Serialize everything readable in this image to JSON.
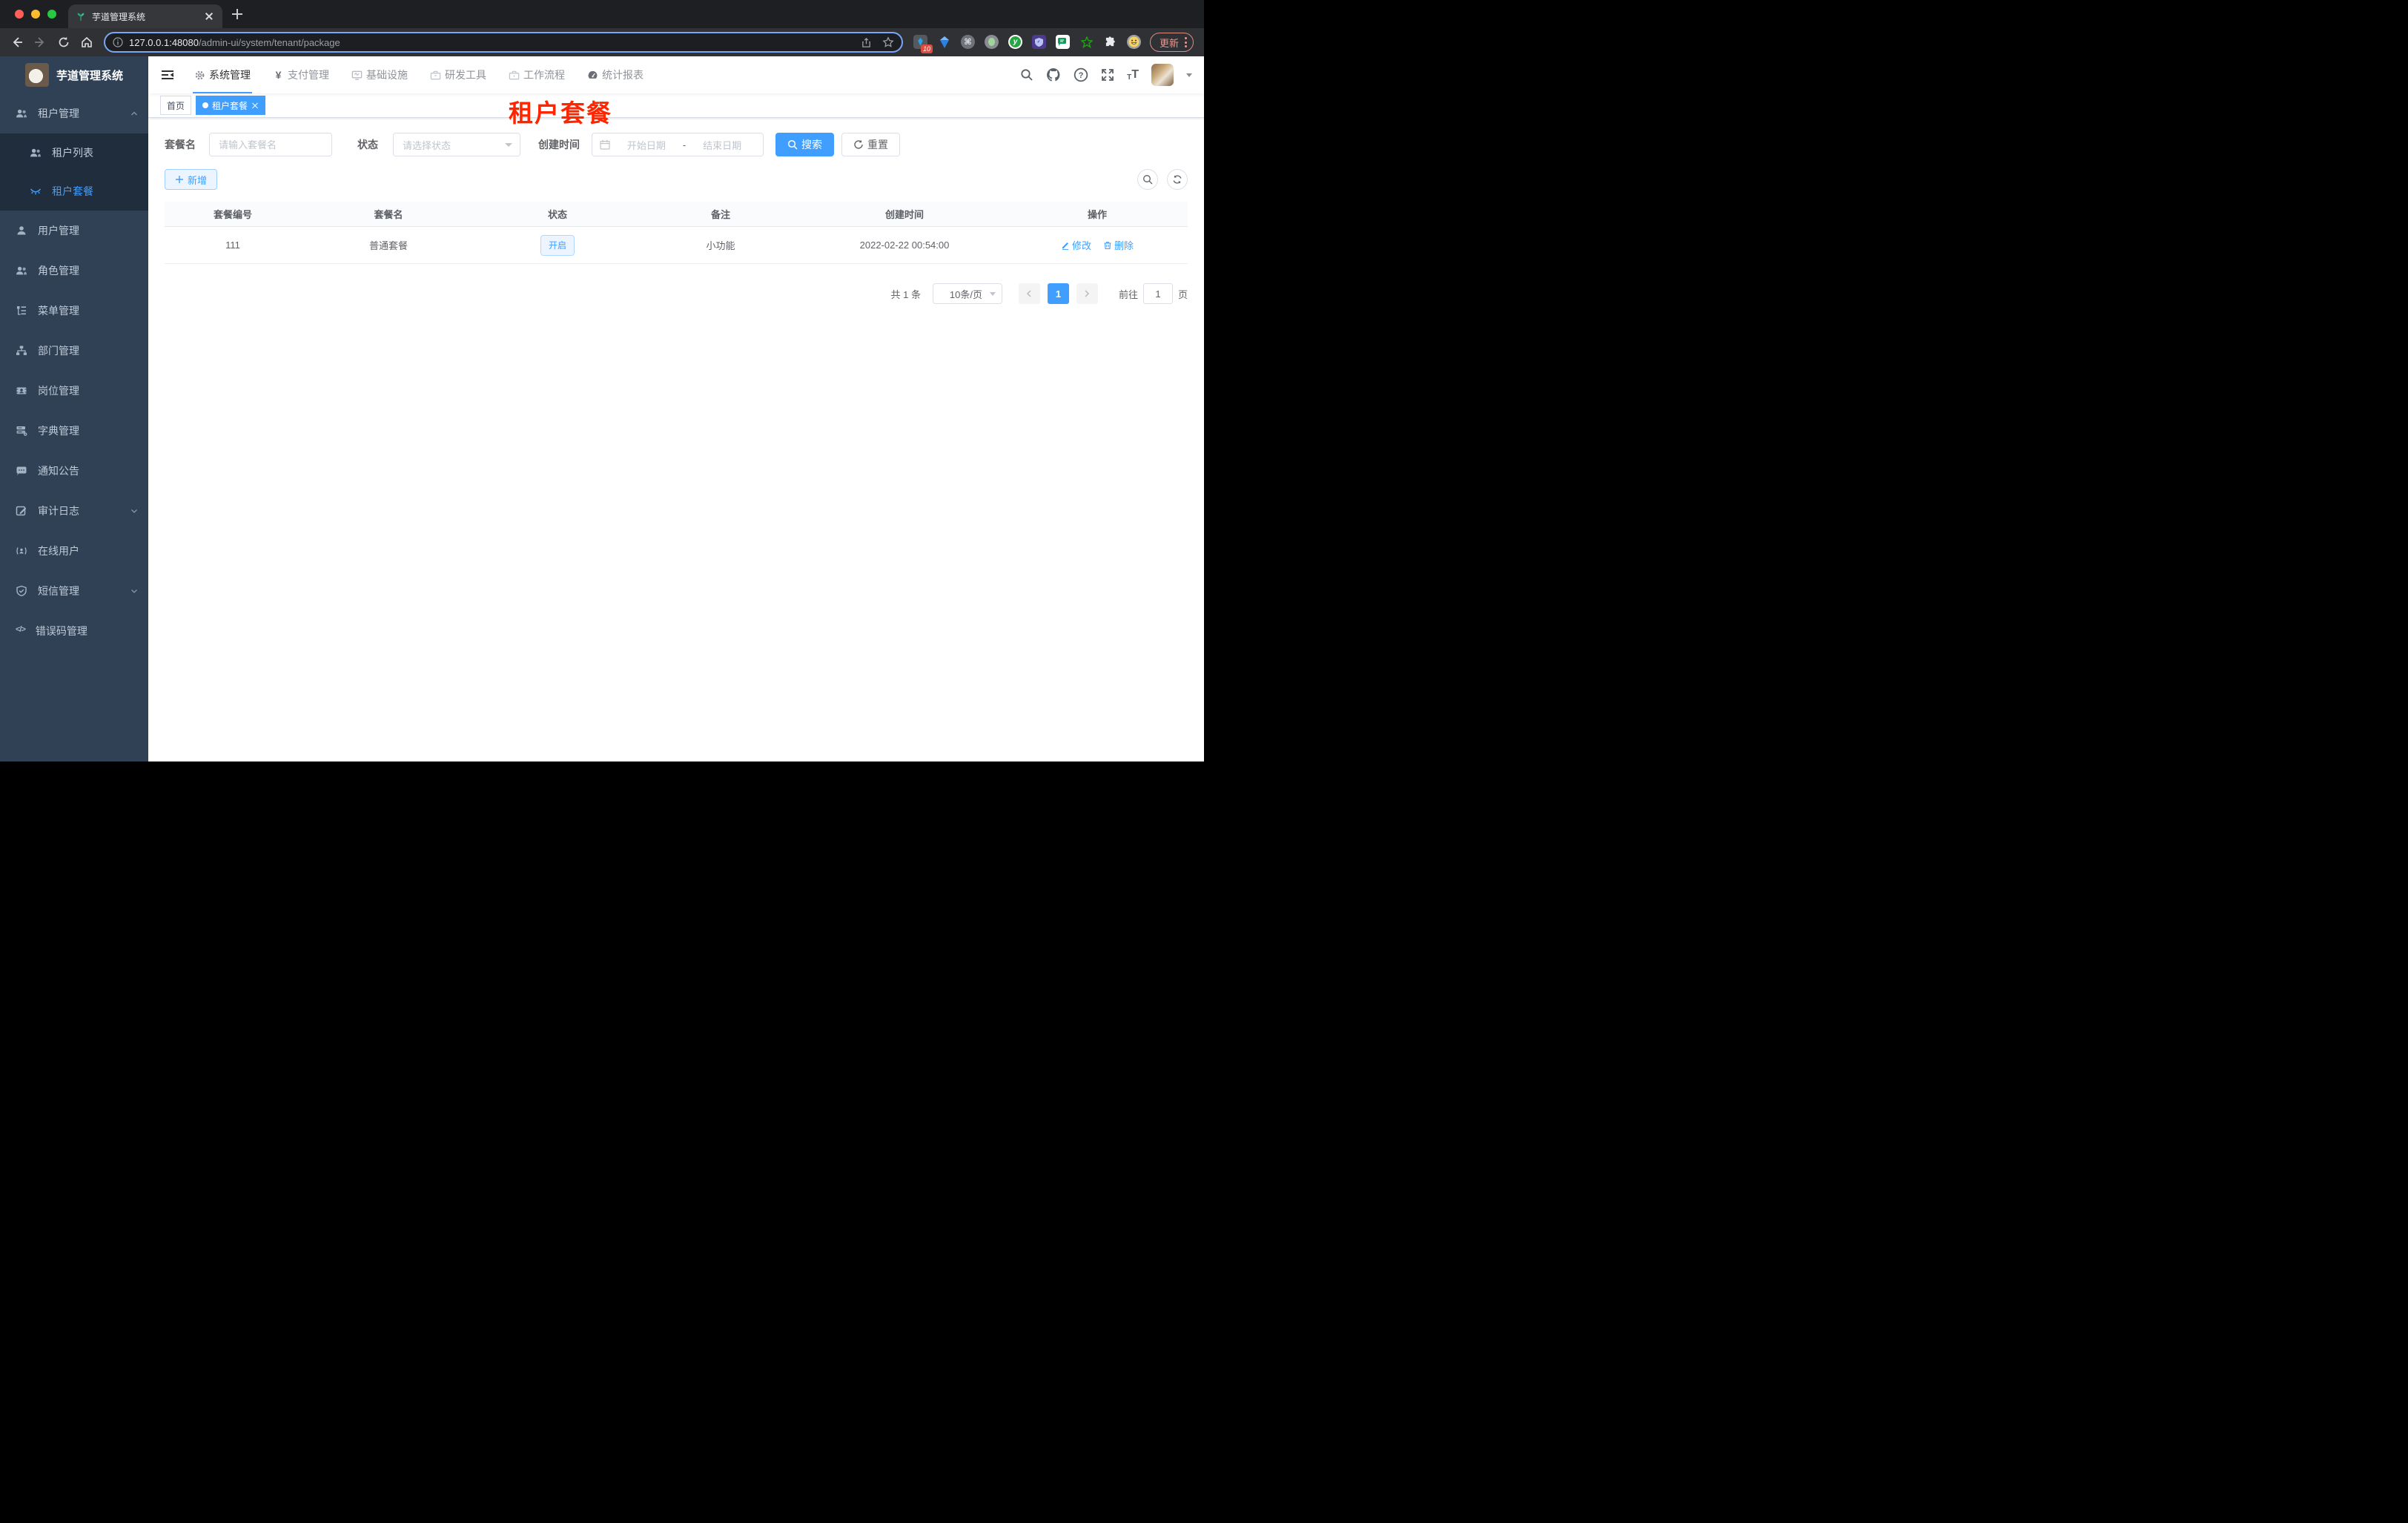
{
  "browser": {
    "tab_title": "芋道管理系统",
    "url_host": "127.0.0.1:48080",
    "url_path": "/admin-ui/system/tenant/package",
    "extension_badge": "10",
    "update_label": "更新"
  },
  "glyphs": {
    "yen": "¥",
    "question": "?",
    "code": "</>",
    "command": "⌘",
    "y_ext": "y",
    "font_small": "T",
    "font_big": "T"
  },
  "sidebar": {
    "logo_title": "芋道管理系统",
    "items": [
      {
        "label": "租户管理",
        "icon": "peoples-icon"
      },
      {
        "label": "租户列表",
        "icon": "peoples-icon"
      },
      {
        "label": "租户套餐",
        "icon": "package-icon"
      },
      {
        "label": "用户管理",
        "icon": "user-icon"
      },
      {
        "label": "角色管理",
        "icon": "peoples-icon"
      },
      {
        "label": "菜单管理",
        "icon": "tree-table-icon"
      },
      {
        "label": "部门管理",
        "icon": "org-tree-icon"
      },
      {
        "label": "岗位管理",
        "icon": "post-icon"
      },
      {
        "label": "字典管理",
        "icon": "dict-icon"
      },
      {
        "label": "通知公告",
        "icon": "message-icon"
      },
      {
        "label": "审计日志",
        "icon": "log-icon"
      },
      {
        "label": "在线用户",
        "icon": "online-icon"
      },
      {
        "label": "短信管理",
        "icon": "shield-icon"
      },
      {
        "label": "错误码管理",
        "icon": "code-icon"
      }
    ]
  },
  "nav": {
    "items": [
      {
        "label": "系统管理",
        "icon": "gear-icon",
        "active": true
      },
      {
        "label": "支付管理",
        "icon": "yen-icon"
      },
      {
        "label": "基础设施",
        "icon": "monitor-icon"
      },
      {
        "label": "研发工具",
        "icon": "toolbox-icon"
      },
      {
        "label": "工作流程",
        "icon": "briefcase-icon"
      },
      {
        "label": "统计报表",
        "icon": "dashboard-icon"
      }
    ]
  },
  "tags": {
    "home": "首页",
    "active": "租户套餐"
  },
  "annotation": "租户套餐",
  "filters": {
    "name_label": "套餐名",
    "name_placeholder": "请输入套餐名",
    "status_label": "状态",
    "status_placeholder": "请选择状态",
    "date_label": "创建时间",
    "date_start_placeholder": "开始日期",
    "date_separator": "-",
    "date_end_placeholder": "结束日期",
    "search_label": "搜索",
    "reset_label": "重置"
  },
  "toolbar": {
    "add_label": "新增"
  },
  "table": {
    "columns": [
      "套餐编号",
      "套餐名",
      "状态",
      "备注",
      "创建时间",
      "操作"
    ],
    "rows": [
      {
        "id": "111",
        "name": "普通套餐",
        "status": "开启",
        "remark": "小功能",
        "created": "2022-02-22 00:54:00",
        "edit_label": "修改",
        "delete_label": "删除"
      }
    ]
  },
  "pagination": {
    "total": "共 1 条",
    "page_size": "10条/页",
    "current_page": "1",
    "goto_label": "前往",
    "goto_value": "1",
    "page_unit": "页"
  },
  "colors": {
    "primary": "#409eff",
    "sidebar_bg": "#304156",
    "submenu_bg": "#1f2d3d",
    "tag_active": "#409eff",
    "annotation_red": "#fe2600",
    "status_tag_bg": "#ecf5ff"
  }
}
